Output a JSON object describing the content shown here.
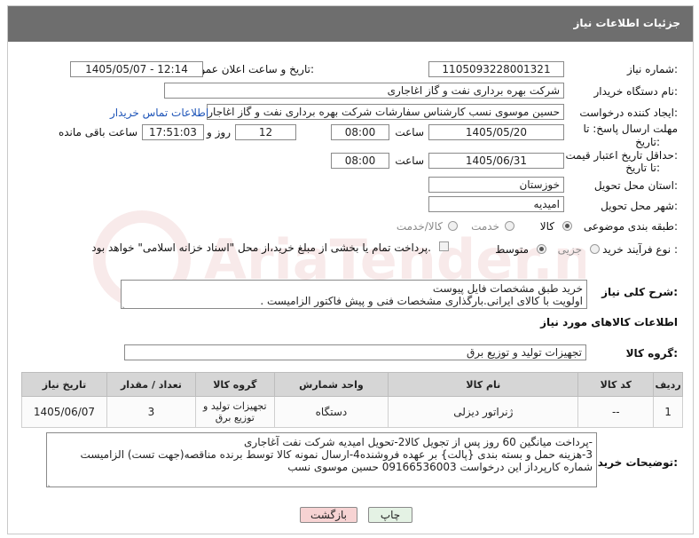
{
  "header": {
    "title": "جزئیات اطلاعات نیاز"
  },
  "fields": {
    "need_number": {
      "label": "شماره نیاز:",
      "value": "1105093228001321"
    },
    "announce": {
      "label": "تاریخ و ساعت اعلان عمومی:",
      "value": "1405/05/07 - 12:14"
    },
    "buyer_org": {
      "label": "نام دستگاه خریدار:",
      "value": "شرکت بهره برداری نفت و گاز اغاجاری"
    },
    "requester": {
      "label": "ایجاد کننده درخواست:",
      "value": "حسین موسوی نسب کارشناس سفارشات شرکت بهره برداری نفت و گاز اغاجار",
      "contact_link": "اطلاعات تماس خریدار"
    },
    "deadline": {
      "label_line1": "مهلت ارسال پاسخ: تا",
      "label_line2": "تاریخ:",
      "date": "1405/05/20",
      "time_label": "ساعت",
      "time": "08:00",
      "days": "12",
      "days_label": "روز و",
      "remaining": "17:51:03",
      "remaining_label": "ساعت باقی مانده"
    },
    "price_validity": {
      "label_line1": "حداقل تاریخ اعتبار قیمت:",
      "label_line2": "تا تاریخ:",
      "date": "1405/06/31",
      "time_label": "ساعت",
      "time": "08:00"
    },
    "province": {
      "label": "استان محل تحویل:",
      "value": "خوزستان"
    },
    "city": {
      "label": "شهر محل تحویل:",
      "value": "امیدیه"
    },
    "category": {
      "label": "طبقه بندی موضوعی:",
      "options": [
        "کالا",
        "خدمت",
        "کالا/خدمت"
      ],
      "selected": "کالا"
    },
    "process": {
      "label": "نوع فرآیند خرید :",
      "options": [
        "جزیی",
        "متوسط"
      ],
      "selected": "متوسط",
      "payment_note": "پرداخت تمام یا بخشی از مبلغ خرید،از محل \"اسناد خزانه اسلامی\" خواهد بود."
    }
  },
  "summary": {
    "label": "شرح کلی نیاز:",
    "line1": "خرید طبق  مشخصات فایل پیوست",
    "line2": "اولویت با کالای ایرانی.بارگذاری مشخصات فنی و پیش فاکتور الزامیست ."
  },
  "goods_info": {
    "title": "اطلاعات کالاهای مورد نیاز",
    "group_label": "گروه کالا:",
    "group_value": "تجهیزات تولید و توزیع برق"
  },
  "table": {
    "headers": [
      "ردیف",
      "کد کالا",
      "نام کالا",
      "واحد شمارش",
      "گروه کالا",
      "تعداد / مقدار",
      "تاریخ نیاز"
    ],
    "rows": [
      [
        "1",
        "--",
        "ژنراتور دیزلی",
        "دستگاه",
        "تجهیزات تولید و توزیع برق",
        "3",
        "1405/06/07"
      ]
    ]
  },
  "buyer_notes": {
    "label": "توضیحات خریدار:",
    "line1": "-پرداخت میانگین 60 روز پس از تجویل کالا2-تحویل امیدیه شرکت نفت آغاجاری",
    "line2": "3-هزینه حمل  و بسته بندی {پالت} بر عهده فروشنده4-ارسال نمونه کالا توسط برنده مناقصه(جهت تست) الزامیست",
    "line3": "شماره کارپرداز این درخواست 09166536003 حسین موسوی نسب"
  },
  "buttons": {
    "print": "چاپ",
    "back": "بازگشت"
  },
  "watermark": {
    "text": "AriaTender.net"
  },
  "colors": {
    "header_bg": "#6e6e6e",
    "link": "#1d54b8",
    "back_button_bg": "#f7d3d3",
    "print_button_bg": "#e4f2e4"
  }
}
